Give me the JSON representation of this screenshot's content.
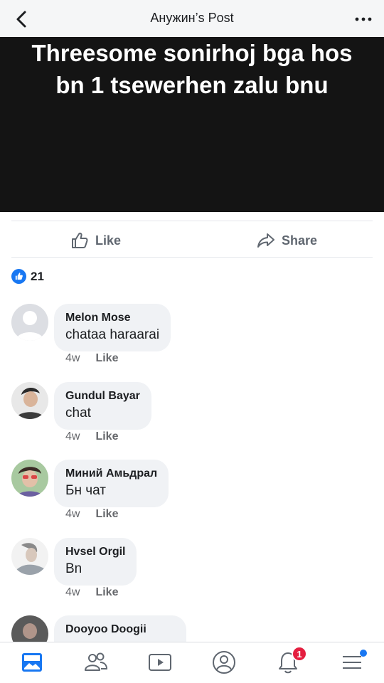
{
  "header": {
    "title": "Анужин’s Post",
    "back_icon": "chevron-left-icon",
    "more_icon": "more-horizontal-icon"
  },
  "post": {
    "text": "Threesome sonirhoj bga hos bn 1 tsewerhen zalu bnu",
    "background_color": "#141414"
  },
  "actions": {
    "like_label": "Like",
    "share_label": "Share"
  },
  "reactions": {
    "count": "21"
  },
  "comments": [
    {
      "name": "Melon Mose",
      "text": "chataa haraarai",
      "time": "4w",
      "like_label": "Like"
    },
    {
      "name": "Gundul Bayar",
      "text": "chat",
      "time": "4w",
      "like_label": "Like"
    },
    {
      "name": "Миний Амьдрал",
      "text": "Бн чат",
      "time": "4w",
      "like_label": "Like"
    },
    {
      "name": "Hvsel Orgil",
      "text": "Bn",
      "time": "4w",
      "like_label": "Like"
    },
    {
      "name": "Dooyoo Doogii",
      "text": "",
      "time": "",
      "like_label": ""
    }
  ],
  "tabbar": {
    "items": [
      "news-feed-icon",
      "friends-icon",
      "watch-icon",
      "profile-icon",
      "notifications-icon",
      "menu-icon"
    ],
    "notification_badge": "1",
    "accent_color": "#1877f2"
  }
}
